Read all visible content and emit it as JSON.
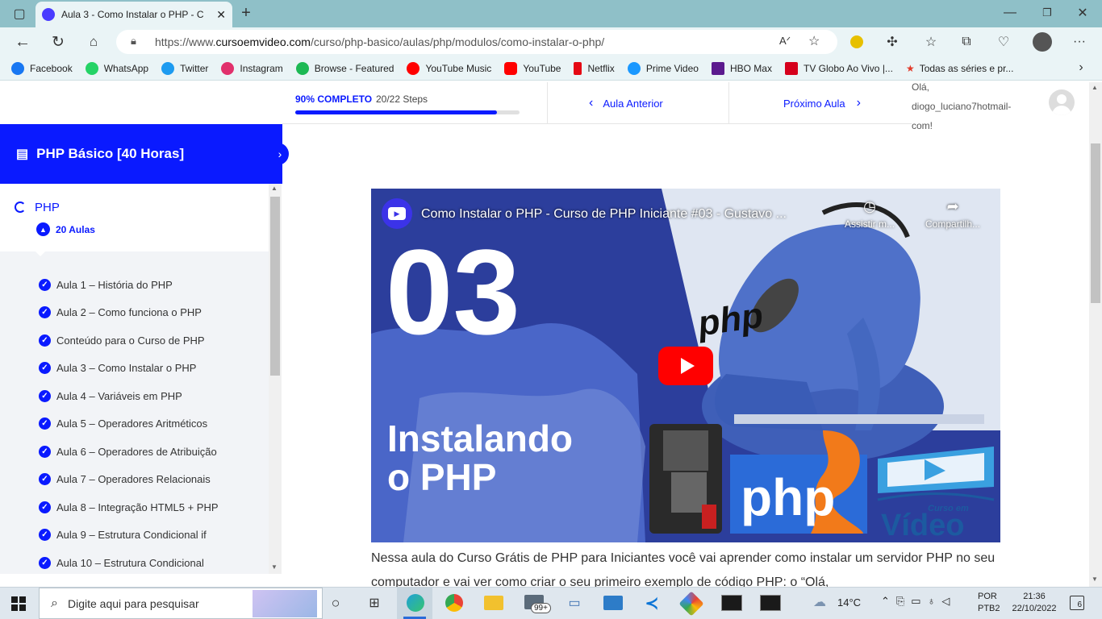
{
  "browser": {
    "tab_title": "Aula 3 - Como Instalar o PHP - C",
    "url_prefix": "https://www.",
    "url_host": "cursoemvideo.com",
    "url_path": "/curso/php-basico/aulas/php/modulos/como-instalar-o-php/",
    "bookmarks": [
      "Facebook",
      "WhatsApp",
      "Twitter",
      "Instagram",
      "Browse - Featured",
      "YouTube Music",
      "YouTube",
      "Netflix",
      "Prime Video",
      "HBO Max",
      "TV Globo Ao Vivo |...",
      "Todas as séries e pr..."
    ]
  },
  "progress": {
    "label": "90% COMPLETO",
    "steps": "20/22 Steps",
    "fraction": 0.9
  },
  "nav": {
    "prev": "Aula Anterior",
    "next": "Próximo Aula"
  },
  "user": {
    "greeting": "Olá,",
    "name": "diogo_luciano7hotmail-",
    "suffix": "com!"
  },
  "course": {
    "title": "PHP Básico [40 Horas]"
  },
  "section": {
    "title": "PHP",
    "count": "20 Aulas"
  },
  "lessons": [
    "Aula 1 – História do PHP",
    "Aula 2 – Como funciona o PHP",
    "Conteúdo para o Curso de PHP",
    "Aula 3 – Como Instalar o PHP",
    "Aula 4 – Variáveis em PHP",
    "Aula 5 – Operadores Aritméticos",
    "Aula 6 – Operadores de Atribuição",
    "Aula 7 – Operadores Relacionais",
    "Aula 8 – Integração HTML5 + PHP",
    "Aula 9 – Estrutura Condicional if",
    "Aula 10 – Estrutura Condicional"
  ],
  "video": {
    "title": "Como Instalar o PHP - Curso de PHP Iniciante #03 - Gustavo ...",
    "watch_later": "Assistir m...",
    "share": "Compartilh...",
    "number": "03",
    "overlay_line1": "Instalando",
    "overlay_line2": "o PHP",
    "php_word": "php",
    "brand_small": "Curso em",
    "brand_big": "Vídeo"
  },
  "description": "Nessa aula do Curso Grátis de PHP para Iniciantes você vai aprender como instalar um servidor PHP no seu computador e vai ver como criar o seu primeiro exemplo de código PHP: o “Olá,",
  "taskbar": {
    "search_placeholder": "Digite aqui para pesquisar",
    "weather": "14°C",
    "lang1": "POR",
    "lang2": "PTB2",
    "time": "21:36",
    "date": "22/10/2022",
    "notifications": "6",
    "mail_badge": "99+"
  },
  "colors": {
    "accent": "#0a1aff",
    "tabbar": "#8fc0c8",
    "youtube_red": "#ff0000"
  }
}
